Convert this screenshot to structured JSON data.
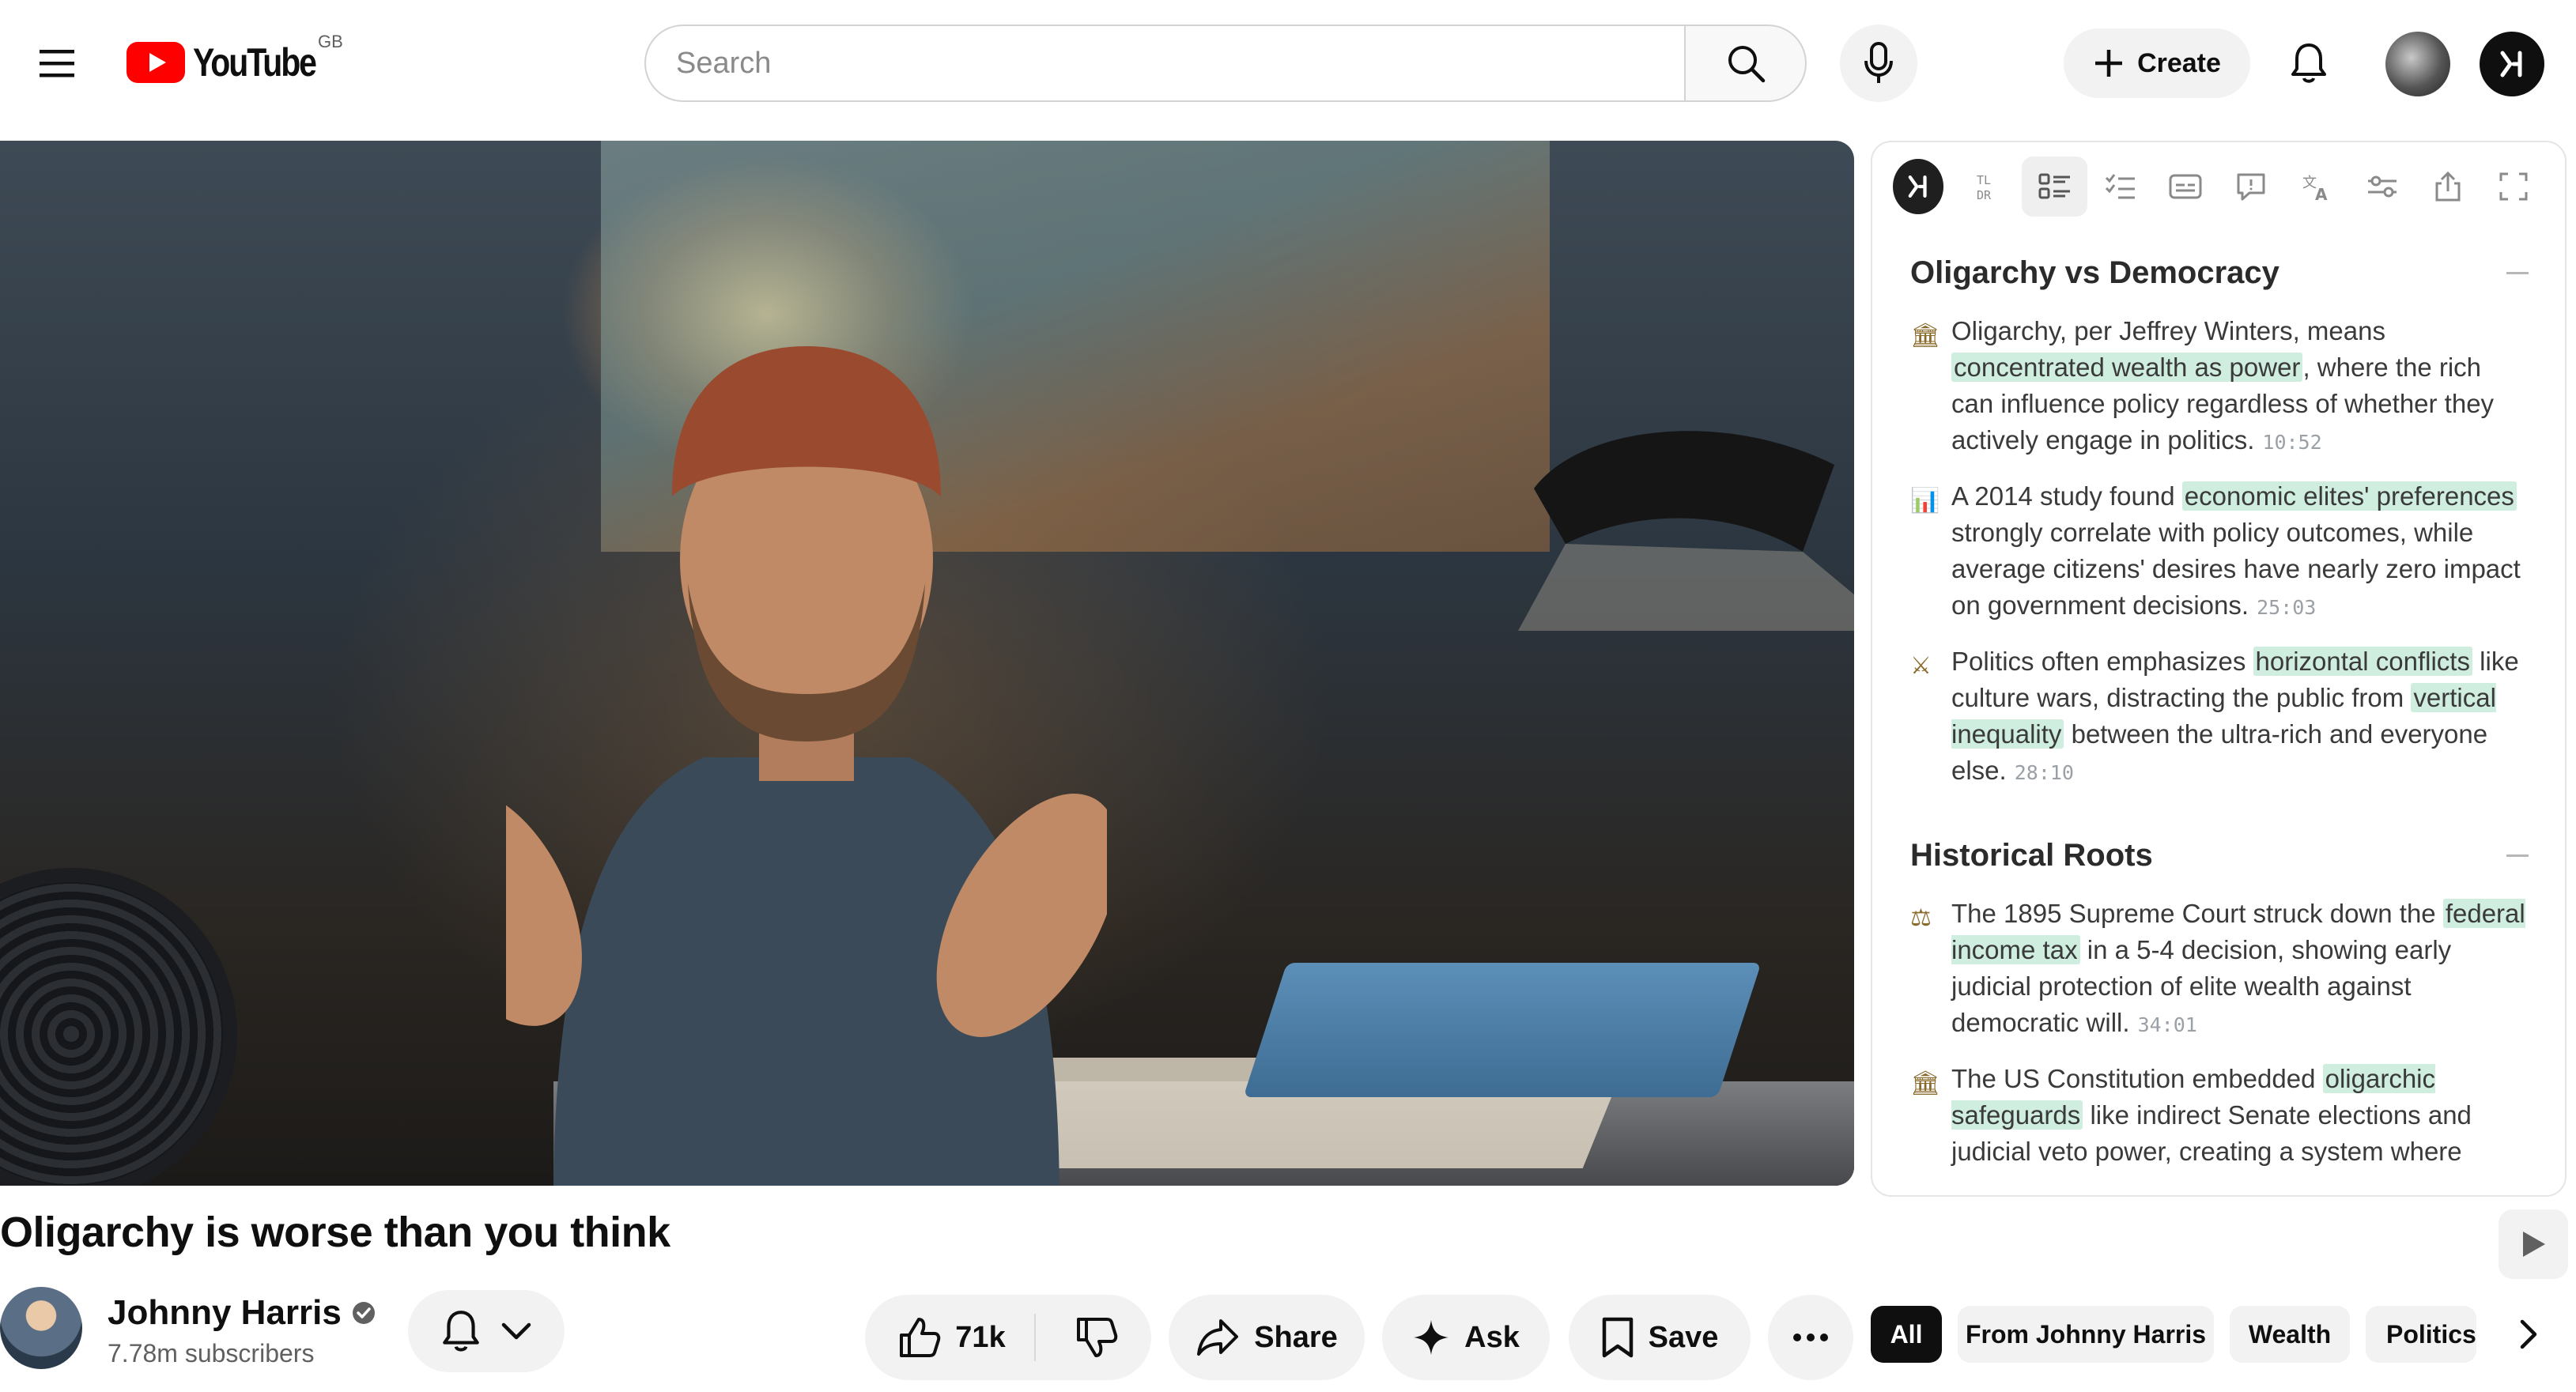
{
  "header": {
    "logo_text": "YouTube",
    "country_code": "GB",
    "search_placeholder": "Search",
    "create_label": "Create"
  },
  "panel": {
    "sections": [
      {
        "title": "Oligarchy vs Democracy",
        "items": [
          {
            "icon": "bank-icon",
            "glyph": "🏛",
            "pre": "Oligarchy, per Jeffrey Winters, means ",
            "hl": "concentrated wealth as power",
            "post": ", where the rich can influence policy regardless of whether they actively engage in politics.",
            "hl2": "",
            "post2": "",
            "time": "10:52"
          },
          {
            "icon": "bar-chart-icon",
            "glyph": "📊",
            "pre": "A 2014 study found ",
            "hl": "economic elites' preferences",
            "post": " strongly correlate with policy outcomes, while average citizens' desires have nearly zero impact on government decisions.",
            "hl2": "",
            "post2": "",
            "time": "25:03"
          },
          {
            "icon": "crossed-swords-icon",
            "glyph": "⚔",
            "pre": "Politics often emphasizes ",
            "hl": "horizontal conflicts",
            "post": " like culture wars, distracting the public from ",
            "hl2": "vertical inequality",
            "post2": " between the ultra-rich and everyone else.",
            "time": "28:10"
          }
        ]
      },
      {
        "title": "Historical Roots",
        "items": [
          {
            "icon": "scales-icon",
            "glyph": "⚖",
            "pre": "The 1895 Supreme Court struck down the ",
            "hl": "federal income tax",
            "post": " in a 5-4 decision, showing early judicial protection of elite wealth against democratic will.",
            "hl2": "",
            "post2": "",
            "time": "34:01"
          },
          {
            "icon": "bank-icon",
            "glyph": "🏛",
            "pre": "The US Constitution embedded ",
            "hl": "oligarchic safeguards",
            "post": " like indirect Senate elections and judicial veto power, creating a system where",
            "hl2": "",
            "post2": "",
            "time": ""
          }
        ]
      }
    ]
  },
  "video": {
    "title": "Oligarchy is worse than you think"
  },
  "channel": {
    "name": "Johnny Harris",
    "subscribers": "7.78m subscribers"
  },
  "actions": {
    "like_count": "71k",
    "share_label": "Share",
    "ask_label": "Ask",
    "save_label": "Save"
  },
  "chips": [
    "All",
    "From Johnny Harris",
    "Wealth",
    "Politics"
  ],
  "colors": {
    "brand_red": "#ff0000",
    "highlight": "#cfeee0",
    "chip_active": "#0f0f0f"
  }
}
